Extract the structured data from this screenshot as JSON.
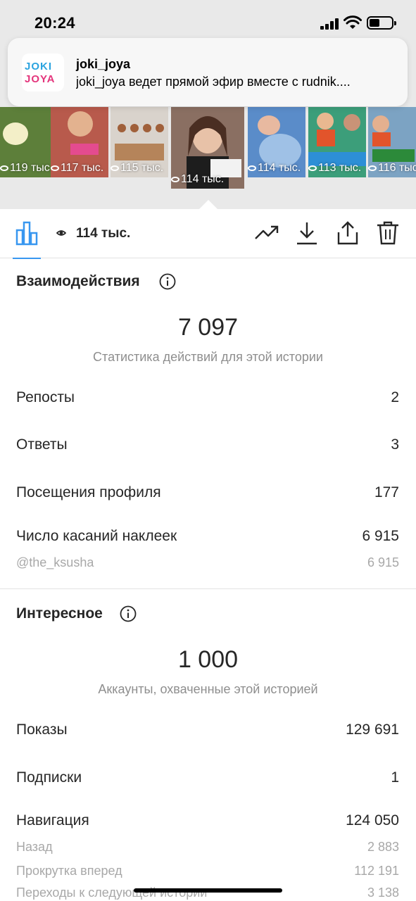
{
  "status_bar": {
    "time": "20:24"
  },
  "notification": {
    "logo_line1": "JOKI",
    "logo_line2": "JOYA",
    "title": "joki_joya",
    "text": "joki_joya ведет прямой эфир вместе с rudnik...."
  },
  "thumbnails": [
    {
      "count": "119 тыс.",
      "color": "#5d7f3a"
    },
    {
      "count": "117 тыс.",
      "color": "#b85a4c"
    },
    {
      "count": "115 тыс.",
      "color": "#d9d3cc"
    },
    {
      "count": "114 тыс.",
      "color": "#8a6f62",
      "active": true
    },
    {
      "count": "114 тыс.",
      "color": "#5a8cc9"
    },
    {
      "count": "113 тыс.",
      "color": "#3c9e7a"
    },
    {
      "count": "116 тыс.",
      "color": "#7ca3c3"
    }
  ],
  "toolbar": {
    "views": "114 тыс.",
    "accent_color": "#3897f0"
  },
  "interactions": {
    "title": "Взаимодействия",
    "total": "7 097",
    "total_caption": "Статистика действий для этой истории",
    "rows": [
      {
        "label": "Репосты",
        "value": "2"
      },
      {
        "label": "Ответы",
        "value": "3"
      },
      {
        "label": "Посещения профиля",
        "value": "177"
      },
      {
        "label": "Число касаний наклеек",
        "value": "6 915"
      }
    ],
    "sub_rows": [
      {
        "label": "@the_ksusha",
        "value": "6 915"
      }
    ]
  },
  "discovery": {
    "title": "Интересное",
    "total": "1 000",
    "total_caption": "Аккаунты, охваченные этой историей",
    "rows": [
      {
        "label": "Показы",
        "value": "129 691"
      },
      {
        "label": "Подписки",
        "value": "1"
      },
      {
        "label": "Навигация",
        "value": "124 050"
      }
    ],
    "sub_rows": [
      {
        "label": "Назад",
        "value": "2 883"
      },
      {
        "label": "Прокрутка вперед",
        "value": "112 191"
      },
      {
        "label": "Переходы к следующей истории",
        "value": "3 138"
      }
    ]
  }
}
